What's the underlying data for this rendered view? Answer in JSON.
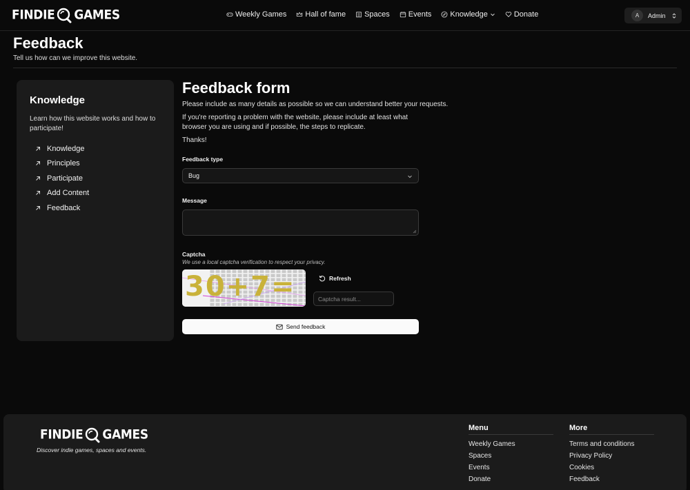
{
  "brand": {
    "left": "FINDIE",
    "right": "GAMES"
  },
  "nav": {
    "items": [
      {
        "label": "Weekly Games",
        "icon": "gamepad-icon"
      },
      {
        "label": "Hall of fame",
        "icon": "crown-icon"
      },
      {
        "label": "Spaces",
        "icon": "building-icon"
      },
      {
        "label": "Events",
        "icon": "calendar-icon"
      },
      {
        "label": "Knowledge",
        "icon": "compass-icon"
      },
      {
        "label": "Donate",
        "icon": "heart-icon"
      }
    ],
    "user": {
      "initial": "A",
      "name": "Admin"
    }
  },
  "page": {
    "title": "Feedback",
    "subtitle": "Tell us how can we improve this website."
  },
  "sidebar": {
    "title": "Knowledge",
    "description": "Learn how this website works and how to participate!",
    "items": [
      {
        "label": "Knowledge"
      },
      {
        "label": "Principles"
      },
      {
        "label": "Participate"
      },
      {
        "label": "Add Content"
      },
      {
        "label": "Feedback"
      }
    ]
  },
  "form": {
    "title": "Feedback form",
    "intro": "Please include as many details as possible so we can understand better your requests.",
    "intro2": "If you're reporting a problem with the website, please include at least what browser you are using and if possible, the steps to replicate.",
    "thanks": "Thanks!",
    "type_label": "Feedback type",
    "type_value": "Bug",
    "message_label": "Message",
    "captcha_label": "Captcha",
    "captcha_note": "We use a local captcha verification to respect your privacy.",
    "captcha_text": "30+7=",
    "refresh_label": "Refresh",
    "captcha_placeholder": "Captcha result...",
    "send_label": "Send feedback"
  },
  "footer": {
    "tagline": "Discover indie games, spaces and events.",
    "menu": {
      "title": "Menu",
      "links": [
        "Weekly Games",
        "Spaces",
        "Events",
        "Donate"
      ]
    },
    "more": {
      "title": "More",
      "links": [
        "Terms and conditions",
        "Privacy Policy",
        "Cookies",
        "Feedback"
      ]
    }
  },
  "colors": {
    "background": "#0a0a0a",
    "card": "#1b1b1b",
    "button": "#fafafa"
  }
}
